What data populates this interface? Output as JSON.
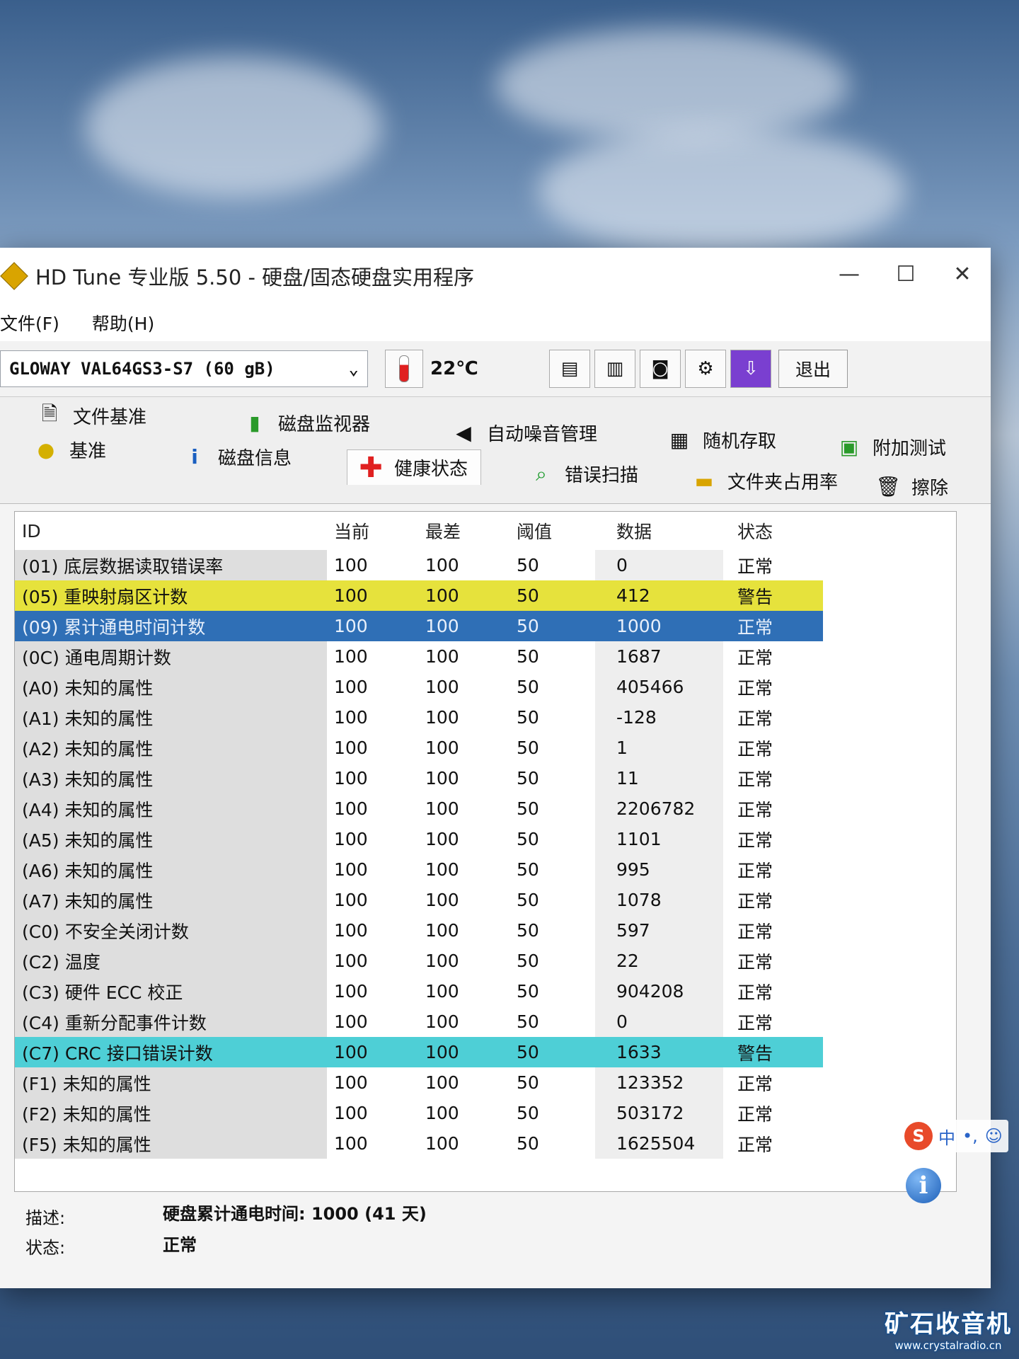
{
  "window": {
    "title": "HD Tune 专业版 5.50 - 硬盘/固态硬盘实用程序",
    "controls": {
      "minimize": "—",
      "maximize": "☐",
      "close": "✕"
    }
  },
  "menu": {
    "file": "文件(F)",
    "help": "帮助(H)"
  },
  "toolbar": {
    "drive": "GLOWAY VAL64GS3-S7 (60 gB)",
    "temperature": "22℃",
    "exit_label": "退出",
    "icons": [
      "copy-info-icon",
      "copy-screen-icon",
      "camera-icon",
      "options-icon",
      "download-icon"
    ]
  },
  "tabs": {
    "row1": [
      {
        "label": "文件基准",
        "icon": "file-benchmark-icon"
      },
      {
        "label": "磁盘监视器",
        "icon": "disk-monitor-icon"
      },
      {
        "label": "自动噪音管理",
        "icon": "speaker-icon"
      },
      {
        "label": "随机存取",
        "icon": "random-access-icon"
      },
      {
        "label": "附加测试",
        "icon": "extra-tests-icon"
      }
    ],
    "row2": [
      {
        "label": "基准",
        "icon": "benchmark-icon"
      },
      {
        "label": "磁盘信息",
        "icon": "info-icon"
      },
      {
        "label": "健康状态",
        "icon": "health-cross-icon"
      },
      {
        "label": "错误扫描",
        "icon": "magnifier-icon"
      },
      {
        "label": "文件夹占用率",
        "icon": "folder-icon"
      },
      {
        "label": "擦除",
        "icon": "trash-icon"
      }
    ]
  },
  "table": {
    "headers": [
      "ID",
      "当前",
      "最差",
      "阈值",
      "数据",
      "状态"
    ],
    "rows": [
      [
        "(01) 底层数据读取错误率",
        "100",
        "100",
        "50",
        "0",
        "正常"
      ],
      [
        "(05) 重映射扇区计数",
        "100",
        "100",
        "50",
        "412",
        "警告"
      ],
      [
        "(09) 累计通电时间计数",
        "100",
        "100",
        "50",
        "1000",
        "正常"
      ],
      [
        "(0C) 通电周期计数",
        "100",
        "100",
        "50",
        "1687",
        "正常"
      ],
      [
        "(A0) 未知的属性",
        "100",
        "100",
        "50",
        "405466",
        "正常"
      ],
      [
        "(A1) 未知的属性",
        "100",
        "100",
        "50",
        "-128",
        "正常"
      ],
      [
        "(A2) 未知的属性",
        "100",
        "100",
        "50",
        "1",
        "正常"
      ],
      [
        "(A3) 未知的属性",
        "100",
        "100",
        "50",
        "11",
        "正常"
      ],
      [
        "(A4) 未知的属性",
        "100",
        "100",
        "50",
        "2206782",
        "正常"
      ],
      [
        "(A5) 未知的属性",
        "100",
        "100",
        "50",
        "1101",
        "正常"
      ],
      [
        "(A6) 未知的属性",
        "100",
        "100",
        "50",
        "995",
        "正常"
      ],
      [
        "(A7) 未知的属性",
        "100",
        "100",
        "50",
        "1078",
        "正常"
      ],
      [
        "(C0) 不安全关闭计数",
        "100",
        "100",
        "50",
        "597",
        "正常"
      ],
      [
        "(C2) 温度",
        "100",
        "100",
        "50",
        "22",
        "正常"
      ],
      [
        "(C3) 硬件 ECC 校正",
        "100",
        "100",
        "50",
        "904208",
        "正常"
      ],
      [
        "(C4) 重新分配事件计数",
        "100",
        "100",
        "50",
        "0",
        "正常"
      ],
      [
        "(C7) CRC 接口错误计数",
        "100",
        "100",
        "50",
        "1633",
        "警告"
      ],
      [
        "(F1) 未知的属性",
        "100",
        "100",
        "50",
        "123352",
        "正常"
      ],
      [
        "(F2) 未知的属性",
        "100",
        "100",
        "50",
        "503172",
        "正常"
      ],
      [
        "(F5) 未知的属性",
        "100",
        "100",
        "50",
        "1625504",
        "正常"
      ]
    ],
    "highlight_colors": {
      "warning": "#e6e23c",
      "selected": "#2f6fb6",
      "crc": "#4ecfd6"
    }
  },
  "footer": {
    "desc_label": "描述:",
    "desc_value": "硬盘累计通电时间: 1000 (41 天)",
    "status_label": "状态:",
    "status_value": "正常"
  },
  "ime": {
    "lang": "中",
    "punct": "•,",
    "emoji": "☺"
  },
  "watermark": {
    "title": "矿石收音机",
    "url": "www.crystalradio.cn"
  }
}
